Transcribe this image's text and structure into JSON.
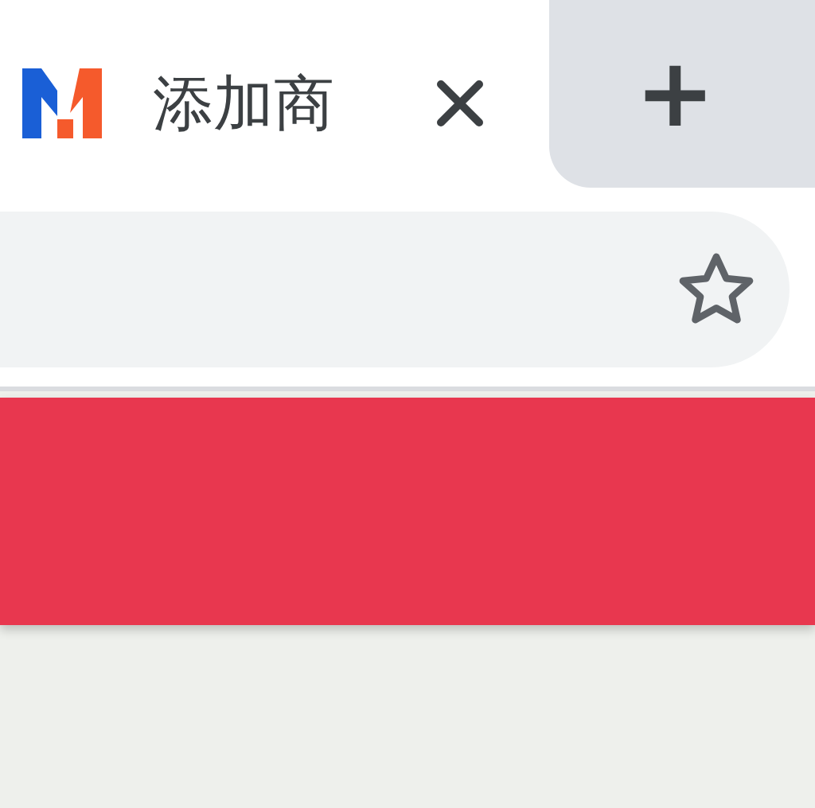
{
  "tab": {
    "title": "添加商",
    "selected": true
  },
  "new_tab": {
    "label": "+"
  },
  "header": {
    "kind": "banner"
  }
}
